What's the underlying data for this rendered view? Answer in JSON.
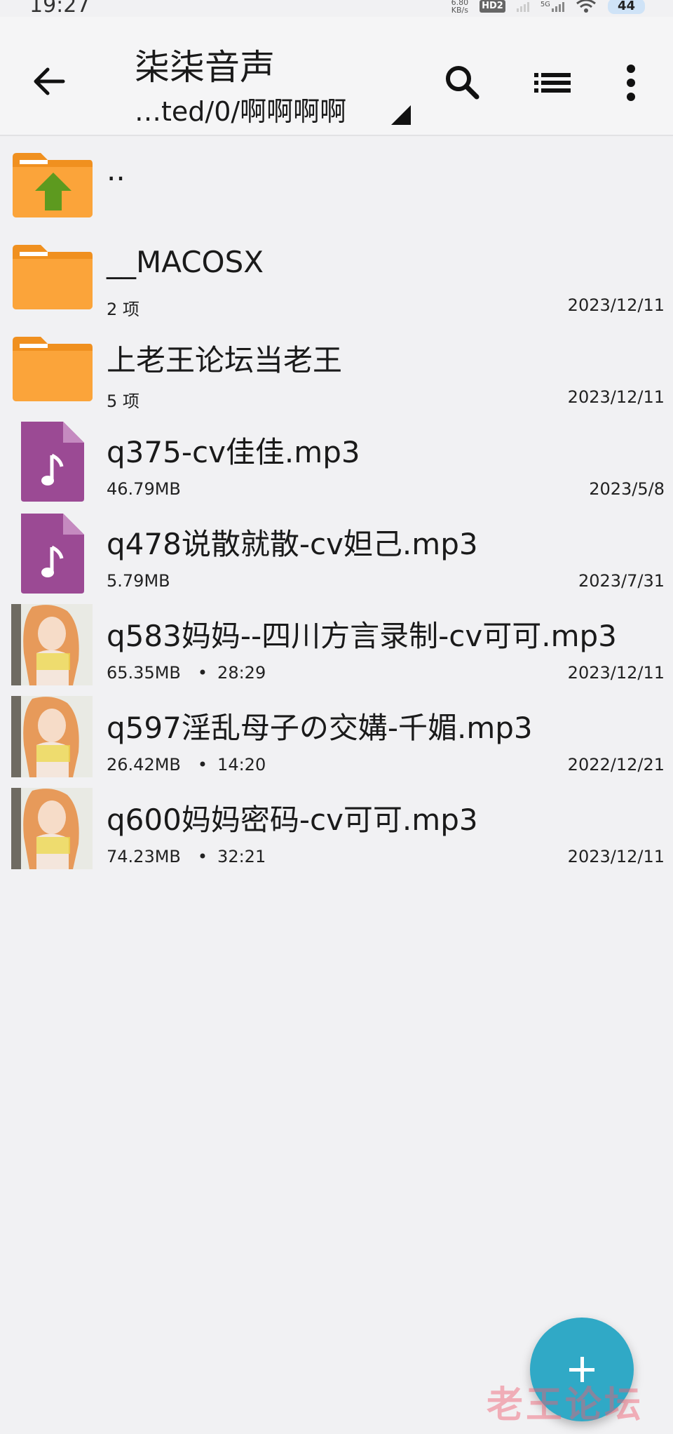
{
  "status_bar": {
    "time": "19:27",
    "net_speed_value": "6.80",
    "net_speed_unit": "KB/s",
    "network_badge": "HD2",
    "network_5g": "5G",
    "battery": "44"
  },
  "app_bar": {
    "title": "柒柒音声",
    "path": "…ted/0/啊啊啊啊",
    "icons": [
      "back-arrow-icon",
      "search-icon",
      "list-view-icon",
      "more-vert-icon"
    ]
  },
  "files": [
    {
      "name": "..",
      "kind": "parent-folder",
      "icon": "folder-up-icon",
      "meta": "",
      "duration": "",
      "date": ""
    },
    {
      "name": "__MACOSX",
      "kind": "folder",
      "icon": "folder-icon",
      "meta": "2 项",
      "duration": "",
      "date": "2023/12/11"
    },
    {
      "name": "上老王论坛当老王",
      "kind": "folder",
      "icon": "folder-icon",
      "meta": "5 项",
      "duration": "",
      "date": "2023/12/11"
    },
    {
      "name": "q375-cv佳佳.mp3",
      "kind": "audio",
      "icon": "audio-file-icon",
      "meta": "46.79MB",
      "duration": "",
      "date": "2023/5/8"
    },
    {
      "name": "q478说散就散-cv妲己.mp3",
      "kind": "audio",
      "icon": "audio-file-icon",
      "meta": "5.79MB",
      "duration": "",
      "date": "2023/7/31"
    },
    {
      "name": "q583妈妈--四川方言录制-cv可可.mp3",
      "kind": "audio-cover",
      "icon": "album-art-thumbnail",
      "meta": "65.35MB",
      "duration": "28:29",
      "date": "2023/12/11"
    },
    {
      "name": "q597淫乱母子の交媾-千媚.mp3",
      "kind": "audio-cover",
      "icon": "album-art-thumbnail",
      "meta": "26.42MB",
      "duration": "14:20",
      "date": "2022/12/21"
    },
    {
      "name": "q600妈妈密码-cv可可.mp3",
      "kind": "audio-cover",
      "icon": "album-art-thumbnail",
      "meta": "74.23MB",
      "duration": "32:21",
      "date": "2023/12/11"
    }
  ],
  "fab": {
    "icon": "plus-icon"
  },
  "watermark": "老王论坛",
  "colors": {
    "folder": "#fba43a",
    "folder_up_arrow": "#5d9a1f",
    "audio_file": "#9b4a94",
    "fab": "#30a9c6",
    "background": "#f1f1f3"
  }
}
